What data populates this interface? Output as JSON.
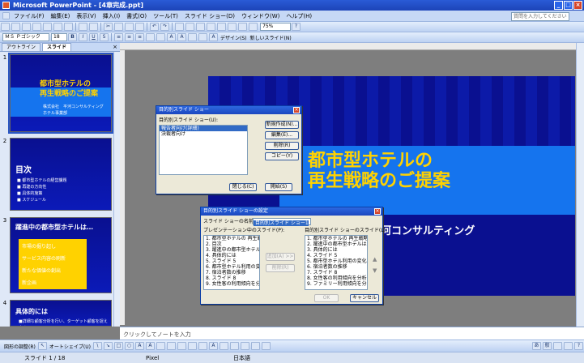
{
  "title": "Microsoft PowerPoint - [4章完成.ppt]",
  "menu": [
    "ファイル(F)",
    "編集(E)",
    "表示(V)",
    "挿入(I)",
    "書式(O)",
    "ツール(T)",
    "スライド ショー(D)",
    "ウィンドウ(W)",
    "ヘルプ(H)"
  ],
  "help_placeholder": "質問を入力してください",
  "toolbar": {
    "zoom": "75%",
    "font": "ＭＳ Ｐゴシック",
    "size": "18",
    "design": "デザイン(S)",
    "new_slide": "新しいスライド(N)"
  },
  "panel_tabs": {
    "outline": "アウトライン",
    "slides": "スライド"
  },
  "thumbs": [
    {
      "num": "1",
      "title": "都市型ホテルの\n再生戦略のご提案",
      "sub": "株式会社　平河コンサルティング\nホテル事業部"
    },
    {
      "num": "2",
      "title": "目次",
      "sub": "■ 都市型ホテルの経営課題\n■ 再建の方向性\n■ 具体的施策\n■ スケジュール"
    },
    {
      "num": "3",
      "title": "躍進中の都市型ホテルは…",
      "sub": "市場の掘り起し\nサービス内容の刷新\n新たな価値の創出\n新企画"
    },
    {
      "num": "4",
      "title": "具体的には",
      "sub": "■詳細な顧客分析を行い、ターゲット顧客を捉え直す"
    }
  ],
  "slide": {
    "title_line1": "都市型ホテルの",
    "title_line2": "再生戦略のご提案",
    "company": "河コンサルティング"
  },
  "dialog_custom": {
    "title": "目的別スライド ショー",
    "list_label": "目的別スライド ショー(U):",
    "items": [
      "報告者向け(詳細)",
      "決裁者向け"
    ],
    "buttons": [
      "新規作成(N)...",
      "編集(E)...",
      "削除(R)",
      "コピー(Y)"
    ],
    "close": "閉じる(C)",
    "start": "開始(S)"
  },
  "dialog_define": {
    "title": "目的別スライド ショーの設定",
    "name_label": "スライド ショーの名前(N):",
    "name_value": "目的別スライド ショー1",
    "left_label": "プレゼンテーション中のスライド(P):",
    "right_label": "目的別スライド ショーのスライド(L):",
    "left_items": [
      "1. 都市型ホテルの 再生戦略",
      "2. 目次",
      "3. 躍進中の都市型ホテルは…",
      "4. 具体的には",
      "5. スライド 5",
      "6. 都市型ホテル利用の変化",
      "7. 宿泊者数の推移",
      "8. スライド 8",
      "9. 女性客の利用傾向を分析"
    ],
    "right_items": [
      "1. 都市型ホテルの 再生戦略",
      "2. 躍進中の都市型ホテルは…",
      "3. 具体的には",
      "4. スライド 5",
      "5. 都市型ホテル利用の変化",
      "6. 宿泊者数の推移",
      "7. スライド 8",
      "8. 女性客の利用傾向を分析",
      "9. ファミリー利用傾向を分析"
    ],
    "add": "追加(A) >>",
    "remove": "削除(R)",
    "ok": "OK",
    "cancel": "キャンセル"
  },
  "notes": "クリックしてノートを入力",
  "draw": {
    "draw_label": "図形の調整(R)",
    "autoshape": "オートシェイプ(U)"
  },
  "status": {
    "slide": "スライド 1 / 18",
    "theme": "Pixel",
    "lang": "日本語"
  },
  "colors": {
    "slide_bg": "#0a1090",
    "band": "#1574ee",
    "title": "#ffd200"
  }
}
